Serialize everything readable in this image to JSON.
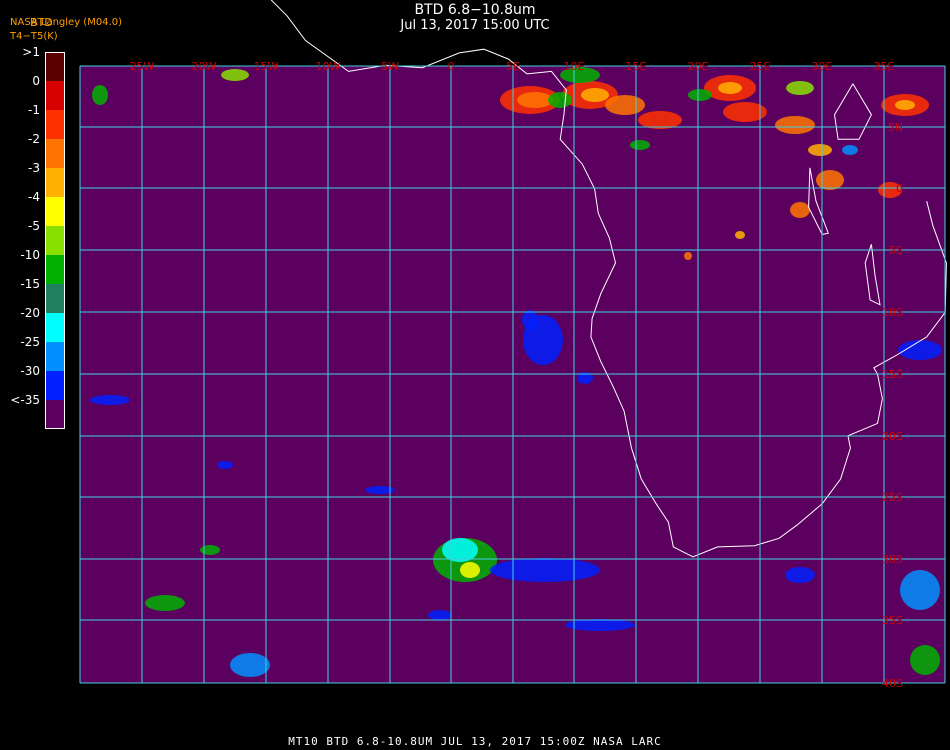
{
  "title": "BTD 6.8−10.8um",
  "subtitle": "Jul 13, 2017 15:00 UTC",
  "source_line1": "NASA Langley (M04.0)",
  "source_line2": "T4−T5(K)",
  "legend": {
    "title": "BTD",
    "entries": [
      {
        "label": ">1",
        "color": "#5a0000"
      },
      {
        "label": "0",
        "color": "#d60000"
      },
      {
        "label": "-1",
        "color": "#ff3000"
      },
      {
        "label": "-2",
        "color": "#ff7400"
      },
      {
        "label": "-3",
        "color": "#ffb000"
      },
      {
        "label": "-4",
        "color": "#ffff00"
      },
      {
        "label": "-5",
        "color": "#88e000"
      },
      {
        "label": "-10",
        "color": "#00b000"
      },
      {
        "label": "-15",
        "color": "#208060"
      },
      {
        "label": "-20",
        "color": "#00ffff"
      },
      {
        "label": "-25",
        "color": "#0090ff"
      },
      {
        "label": "-30",
        "color": "#0020ff"
      },
      {
        "label": "<-35",
        "color": "#5c0060"
      }
    ]
  },
  "map": {
    "background_color": "#5c0060",
    "grid_color": "#40d0e0",
    "coast_color": "#ffffff",
    "lon_labels": [
      "25W",
      "20W",
      "15W",
      "10W",
      "5W",
      "0",
      "5E",
      "10E",
      "15E",
      "20E",
      "25E",
      "30E",
      "35E"
    ],
    "lat_labels": [
      "5N",
      "0",
      "5S",
      "10S",
      "15S",
      "20S",
      "25S",
      "30S",
      "35S",
      "40S"
    ],
    "label_color": "#cc0000"
  },
  "footer": "MT10   BTD 6.8-10.8UM   JUL 13, 2017 15:00Z   NASA LARC"
}
